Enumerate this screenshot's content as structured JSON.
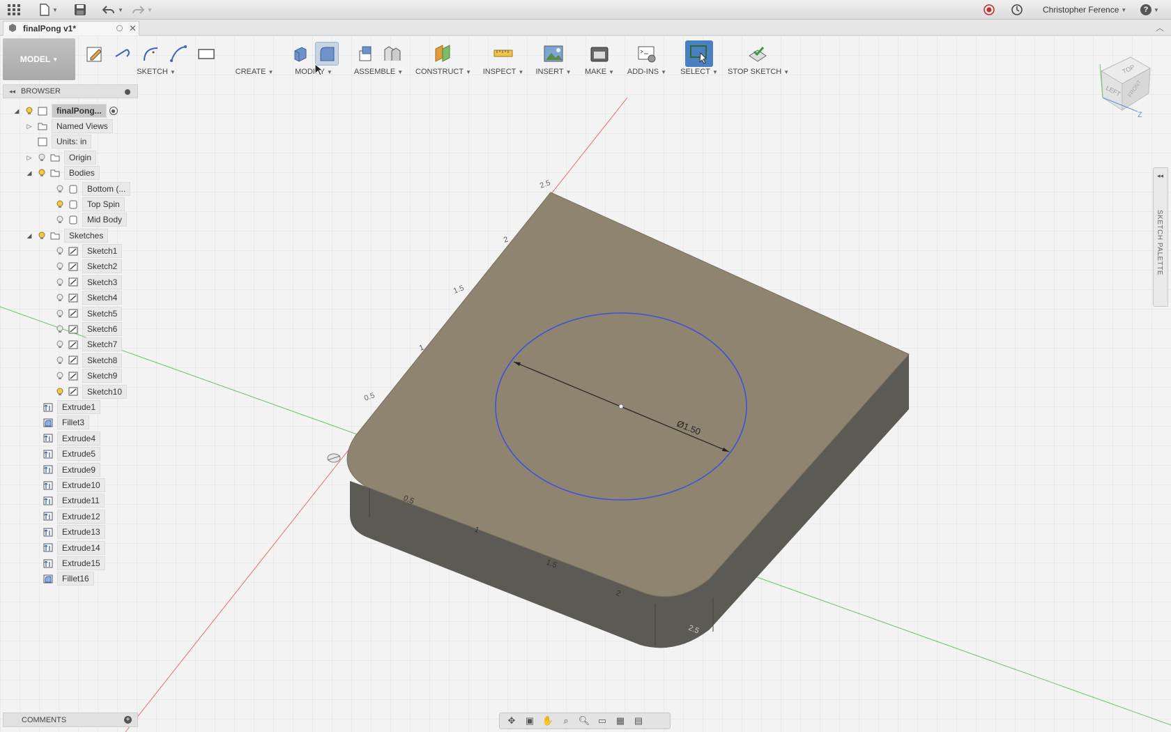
{
  "topbar": {
    "user_name": "Christopher Ference",
    "help_label": "?"
  },
  "document": {
    "tab_title": "finalPong v1*"
  },
  "toolbar": {
    "mode_label": "MODEL",
    "groups": [
      {
        "label": "SKETCH"
      },
      {
        "label": "CREATE"
      },
      {
        "label": "MODIFY"
      },
      {
        "label": "ASSEMBLE"
      },
      {
        "label": "CONSTRUCT"
      },
      {
        "label": "INSPECT"
      },
      {
        "label": "INSERT"
      },
      {
        "label": "MAKE"
      },
      {
        "label": "ADD-INS"
      },
      {
        "label": "SELECT"
      },
      {
        "label": "STOP SKETCH"
      }
    ]
  },
  "browser": {
    "title": "BROWSER",
    "root": "finalPong...",
    "named_views": "Named Views",
    "units": "Units: in",
    "origin": "Origin",
    "bodies": "Bodies",
    "body_items": [
      "Bottom (...",
      "Top Spin",
      "Mid Body"
    ],
    "sketches": "Sketches",
    "sketch_items": [
      "Sketch1",
      "Sketch2",
      "Sketch3",
      "Sketch4",
      "Sketch5",
      "Sketch6",
      "Sketch7",
      "Sketch8",
      "Sketch9",
      "Sketch10"
    ],
    "features": [
      "Extrude1",
      "Fillet3",
      "Extrude4",
      "Extrude5",
      "Extrude9",
      "Extrude10",
      "Extrude11",
      "Extrude12",
      "Extrude13",
      "Extrude14",
      "Extrude15",
      "Fillet16"
    ]
  },
  "comments": {
    "title": "COMMENTS"
  },
  "palette": {
    "title": "SKETCH PALETTE"
  },
  "viewcube": {
    "top": "TOP",
    "left": "LEFT",
    "front": "FRONT",
    "z_axis": "Z"
  },
  "model": {
    "dimension_label": "Ø1.50",
    "ruler_top": [
      "2.5",
      "2",
      "1.5",
      "1",
      "0.5"
    ],
    "ruler_front": [
      "0.5",
      "1",
      "1.5",
      "2",
      "2.5"
    ]
  },
  "colors": {
    "body_top": "#8f8470",
    "body_side": "#5b5a55",
    "circle": "#3a53d8",
    "axis_red": "#e07070",
    "axis_green": "#6cc46c",
    "select_active": "#4a7fc1"
  }
}
